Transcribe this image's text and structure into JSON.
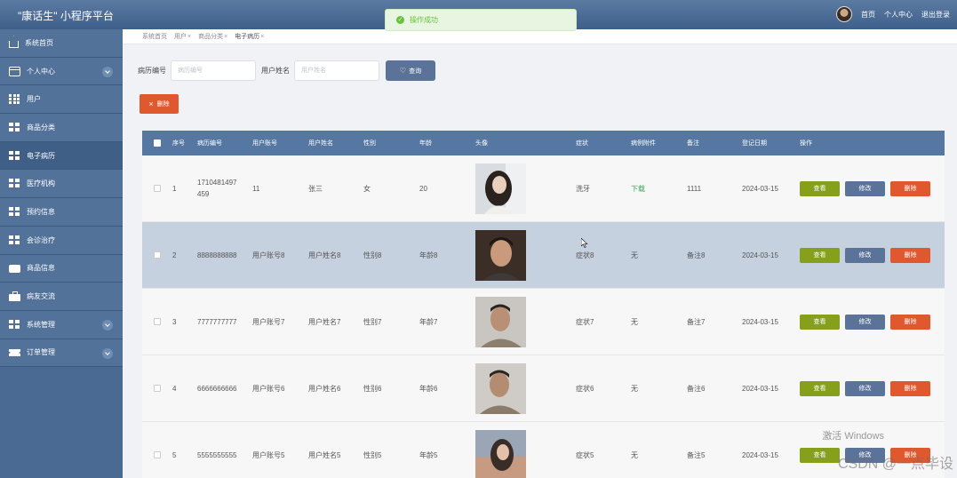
{
  "app": {
    "title": "\"康话生\" 小程序平台"
  },
  "header": {
    "links": [
      "首页",
      "个人中心",
      "退出登录"
    ]
  },
  "toast": {
    "text": "操作成功"
  },
  "sidebar": {
    "items": [
      {
        "label": "系统首页",
        "icon": "home-icon"
      },
      {
        "label": "个人中心",
        "icon": "window-icon",
        "expandable": true
      },
      {
        "label": "用户",
        "icon": "grid-icon"
      },
      {
        "label": "商品分类",
        "icon": "grid-icon"
      },
      {
        "label": "电子病历",
        "icon": "grid-icon",
        "active": true
      },
      {
        "label": "医疗机构",
        "icon": "grid-icon"
      },
      {
        "label": "预约信息",
        "icon": "grid-icon"
      },
      {
        "label": "会诊治疗",
        "icon": "grid-icon"
      },
      {
        "label": "商品信息",
        "icon": "wallet-icon"
      },
      {
        "label": "病友交流",
        "icon": "bag-icon"
      },
      {
        "label": "系统管理",
        "icon": "grid-icon",
        "expandable": true
      },
      {
        "label": "订单管理",
        "icon": "ticket-icon",
        "expandable": true
      }
    ]
  },
  "tabs": [
    {
      "label": "系统首页",
      "closable": false
    },
    {
      "label": "用户",
      "closable": true
    },
    {
      "label": "商品分类",
      "closable": true
    },
    {
      "label": "电子病历",
      "closable": true,
      "active": true
    }
  ],
  "search": {
    "field1_label": "病历编号",
    "field1_placeholder": "病历编号",
    "field2_label": "用户姓名",
    "field2_placeholder": "用户姓名",
    "query_label": "查询"
  },
  "actions": {
    "delete_label": "删除"
  },
  "table": {
    "columns": [
      "序号",
      "病历编号",
      "用户账号",
      "用户姓名",
      "性别",
      "年龄",
      "头像",
      "症状",
      "病例附件",
      "备注",
      "登记日期",
      "操作"
    ],
    "rows": [
      {
        "no": "1",
        "id": "1710481497459",
        "account": "11",
        "name": "张三",
        "sex": "女",
        "age": "20",
        "symptom": "洗牙",
        "file": "下载",
        "note": "1111",
        "date": "2024-03-15"
      },
      {
        "no": "2",
        "id": "8888888888",
        "account": "用户账号8",
        "name": "用户姓名8",
        "sex": "性别8",
        "age": "年龄8",
        "symptom": "症状8",
        "file": "无",
        "note": "备注8",
        "date": "2024-03-15"
      },
      {
        "no": "3",
        "id": "7777777777",
        "account": "用户账号7",
        "name": "用户姓名7",
        "sex": "性别7",
        "age": "年龄7",
        "symptom": "症状7",
        "file": "无",
        "note": "备注7",
        "date": "2024-03-15"
      },
      {
        "no": "4",
        "id": "6666666666",
        "account": "用户账号6",
        "name": "用户姓名6",
        "sex": "性别6",
        "age": "年龄6",
        "symptom": "症状6",
        "file": "无",
        "note": "备注6",
        "date": "2024-03-15"
      },
      {
        "no": "5",
        "id": "5555555555",
        "account": "用户账号5",
        "name": "用户姓名5",
        "sex": "性别5",
        "age": "年龄5",
        "symptom": "症状5",
        "file": "无",
        "note": "备注5",
        "date": "2024-03-15"
      }
    ],
    "op_labels": {
      "view": "查看",
      "edit": "修改",
      "delete": "删除"
    }
  },
  "watermark": {
    "windows": "激活 Windows",
    "csdn": "CSDN @一点毕设"
  },
  "colors": {
    "header": "#4a6a93",
    "accent": "#5577a1",
    "success": "#67c23a",
    "danger": "#e0582e",
    "view": "#86a01c"
  }
}
